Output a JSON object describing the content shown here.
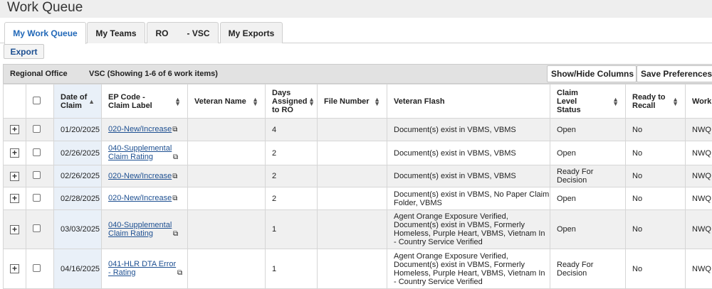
{
  "page": {
    "title": "Work Queue"
  },
  "tabs": [
    {
      "label": "My Work Queue"
    },
    {
      "label": "My Teams"
    },
    {
      "label_a": "RO",
      "label_b": "- VSC"
    },
    {
      "label": "My Exports"
    }
  ],
  "toolbar": {
    "export_label": "Export"
  },
  "grid_bar": {
    "regional_office": "Regional Office",
    "showing": "VSC (Showing 1-6 of 6 work items)",
    "show_hide_label": "Show/Hide Columns",
    "save_prefs_label": "Save Preferences"
  },
  "columns": {
    "date_of_claim": "Date of Claim",
    "ep_code": "EP Code - Claim Label",
    "veteran_name": "Veteran Name",
    "days_assigned": "Days Assigned to RO",
    "file_number": "File Number",
    "veteran_flash": "Veteran Flash",
    "claim_level_status": "Claim Level Status",
    "ready_to_recall": "Ready to Recall",
    "work": "Work T"
  },
  "rows": [
    {
      "expand": "+",
      "date": "01/20/2025",
      "ep": "020-New/Increase",
      "name": "",
      "days": "4",
      "file": "",
      "flash": "Document(s) exist in VBMS, VBMS",
      "status": "Open",
      "recall": "No",
      "work": "NWQ R"
    },
    {
      "expand": "+",
      "date": "02/26/2025",
      "ep": "040-Supplemental Claim Rating",
      "name": "",
      "days": "2",
      "file": "",
      "flash": "Document(s) exist in VBMS, VBMS",
      "status": "Open",
      "recall": "No",
      "work": "NWQ R"
    },
    {
      "expand": "+",
      "date": "02/26/2025",
      "ep": "020-New/Increase",
      "name": "",
      "days": "2",
      "file": "",
      "flash": "Document(s) exist in VBMS, VBMS",
      "status": "Ready For Decision",
      "recall": "No",
      "work": "NWQ R"
    },
    {
      "expand": "+",
      "date": "02/28/2025",
      "ep": "020-New/Increase",
      "name": "",
      "days": "2",
      "file": "",
      "flash": "Document(s) exist in VBMS, No Paper Claim Folder, VBMS",
      "status": "Open",
      "recall": "No",
      "work": "NWQ R"
    },
    {
      "expand": "+",
      "date": "03/03/2025",
      "ep": "040-Supplemental Claim Rating",
      "name": "",
      "days": "1",
      "file": "",
      "flash": "Agent Orange Exposure Verified, Document(s) exist in VBMS, Formerly Homeless, Purple Heart, VBMS, Vietnam In - Country Service Verified",
      "status": "Open",
      "recall": "No",
      "work": "NWQ R"
    },
    {
      "expand": "+",
      "date": "04/16/2025",
      "ep": "041-HLR DTA Error - Rating",
      "name": "",
      "days": "1",
      "file": "",
      "flash": "Agent Orange Exposure Verified, Document(s) exist in VBMS, Formerly Homeless, Purple Heart, VBMS, Vietnam In - Country Service Verified",
      "status": "Ready For Decision",
      "recall": "No",
      "work": "NWQ R"
    }
  ]
}
